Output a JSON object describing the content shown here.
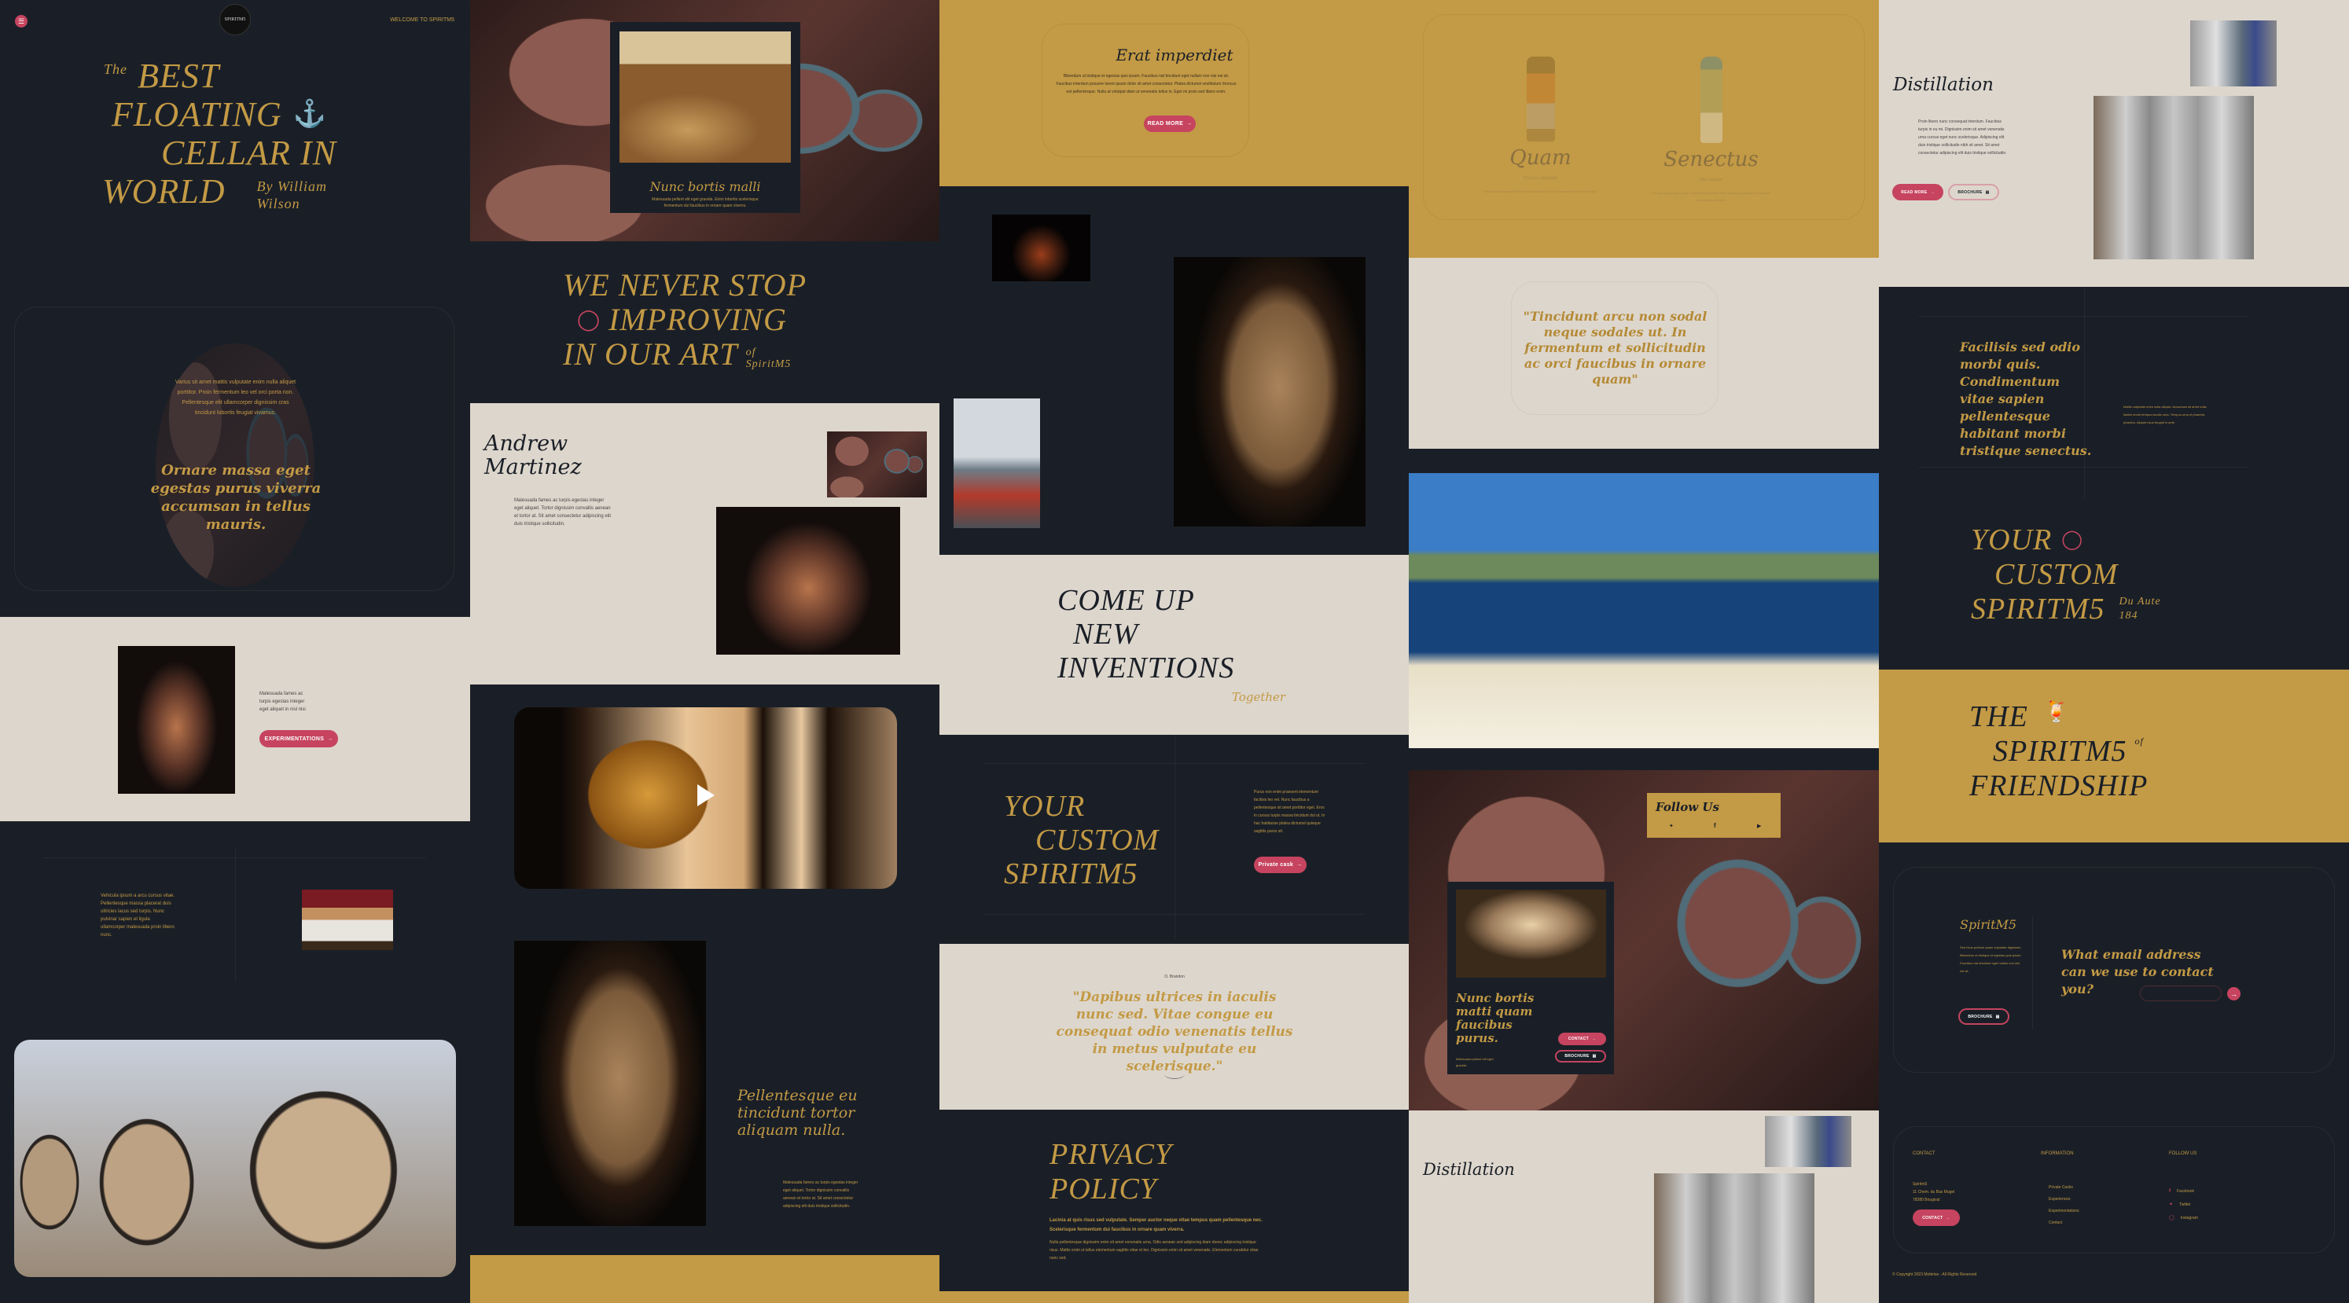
{
  "colors": {
    "navy": "#1a1f27",
    "gold": "#c39a45",
    "beige": "#ddd6cc",
    "pink": "#c6445f"
  },
  "col1": {
    "header": {
      "logo_text": "SPIRITM5",
      "welcome": "WELCOME TO SPIRITM5",
      "menu_icon": "hamburger-icon"
    },
    "hero": {
      "the": "The",
      "line1": "BEST",
      "line2": "FLOATING",
      "line3": "CELLAR IN",
      "line4": "WORLD",
      "byline1": "By William",
      "byline2": "Wilson",
      "icon": "anchor-icon"
    },
    "oval": {
      "body": "Varius sit amet mattis vulputate enim nulla aliquet porttitor. Proin fermentum leo vel orci porta non. Pellentesque elit ullamcorper dignissim cras tincidunt lobortis feugiat vivamus.",
      "quote": "Ornare massa eget egestas purus viverra accumsan in tellus mauris."
    },
    "experiment": {
      "text": "Malesuada fames ac turpis egestas integer eget aliquet in nisl nisi",
      "button": "EXPERIMENTATIONS"
    },
    "split": {
      "text": "Vehicula ipsum a arcu cursus vitae. Pellentesque massa placerat duis ultricies lacus sed turpis. Nunc pulvinar sapien et ligula ullamcorper malesuada proin libero nunc."
    }
  },
  "col2": {
    "card": {
      "title": "Nunc bortis malli",
      "body": "Malesuada pellent elit eget gravida. Enim lobortis scelerisque fermentum dui faucibus in ornare quam viverra."
    },
    "headline": {
      "line1": "WE NEVER STOP",
      "line2": "IMPROVING",
      "line3": "IN OUR ART",
      "of": "of",
      "brand": "SpiritM5",
      "icon": "barrel-icon"
    },
    "person": {
      "name1": "Andrew",
      "name2": "Martinez",
      "body": "Malesuada fames ac turpis egestas integer eget aliquet. Tortor dignissim convallis aenean et tortor at. Sit amet consectetur adipiscing elit duis tristique sollicitudin."
    },
    "video": {
      "play_icon": "play-icon"
    },
    "feature": {
      "title": "Pellentesque eu tincidunt tortor aliquam nulla.",
      "body": "Malesuada fames ac turpis egestas integer eget aliquet. Tortor dignissim convallis aenean et tortor at. Sit amet consectetur adipiscing elit duis tristique sollicitudin."
    }
  },
  "col3": {
    "card": {
      "title": "Erat imperdiet",
      "body": "Bibendum ut tristique et egestas quis ipsum. Faucibus nisl tincidunt eget nullam non nisi est sit. Faucibus interdum posuere lorem ipsum dolor sit amet consectetur. Platea dictumst vestibulum rhoncus est pellentesque. Nulla at volutpat diam ut venenatis tellus in. Eget mi proin sed libero enim.",
      "button": "READ MORE"
    },
    "inventions": {
      "line1": "COME UP",
      "line2": "NEW",
      "line3": "INVENTIONS",
      "tag": "Together"
    },
    "custom": {
      "line1": "YOUR",
      "line2": "CUSTOM",
      "line3": "SPIRITM5",
      "body": "Purus non enim praesent elementum facilisis leo vel. Nunc faucibus a pellentesque sit amet porttitor eget. Eros in cursus turpis massa tincidunt dui ut. In hac habitasse platea dictumst quisque sagittis purus sit.",
      "button": "Private cask"
    },
    "testimonial": {
      "author": "O. Brandon",
      "quote": "\"Dapibus ultrices in iaculis nunc sed. Vitae congue eu consequat odio venenatis tellus in metus vulputate eu scelerisque.\""
    },
    "privacy": {
      "line1": "PRIVACY",
      "line2": "POLICY",
      "lead": "Lacinia at quis risus sed vulputate. Semper auctor neque vitae tempus quam pellentesque nec. Scelerisque fermentum dui faucibus in ornare quam viverra.",
      "body": "Nulla pellentesque dignissim enim sit amet venenatis urna. Odio aenean sed adipiscing diam donec adipiscing tristique risus. Mattis enim ut tellus elementum sagittis vitae et leo. Dignissim enim sit amet venenatis. Elementum curabitur vitae nunc sed."
    }
  },
  "col4": {
    "products": [
      {
        "name": "Quam",
        "subtitle": "Posuere sollicitudin",
        "body": "Faucibus scelerisque eleifend donec pretium. Purus in massa tempor nec feugiat."
      },
      {
        "name": "Senectus",
        "subtitle": "Vitae semper",
        "body": "Posuere lorem ipsum dolor sit amet consectetur. Enim lobortis scelerisque fermentum dui faucibus praesent."
      }
    ],
    "quote": "\"Tincidunt arcu non sodal neque sodales ut. In fermentum et sollicitudin ac orci faucibus in ornare quam\"",
    "follow": {
      "title": "Follow Us",
      "icons": [
        "twitter-icon",
        "facebook-icon",
        "youtube-icon"
      ]
    },
    "card": {
      "title": "Nunc bortis matti quam faucibus purus.",
      "body": "Malesuada pellent elit eget gravida.",
      "contact": "CONTACT",
      "brochure": "BROCHURE"
    },
    "bottom_title": "Distillation"
  },
  "col5": {
    "distill": {
      "title": "Distillation",
      "body": "Proin libero nunc consequat interdum. Faucibus turpis in eu mi. Dignissim enim sit amet venenatis urna cursus eget nunc scelerisque. Adipiscing elit duis tristique sollicitudin nibh sit amet. Sit amet consectetur adipiscing elit duis tristique sollicitudin.",
      "read_more": "READ MORE",
      "brochure": "BROCHURE"
    },
    "facilisis": {
      "title": "Facilisis sed odio morbi quis. Condimentum vitae sapien pellentesque habitant morbi tristique senectus.",
      "body": "Mattis vulputate enim nulla aliquet. Accumsan sit amet nulla facilisi morbi tempus iaculis urna. Tempus urna et pharetra pharetra. Aliquet risus feugiat in ante."
    },
    "custom": {
      "line1": "YOUR",
      "line2": "CUSTOM",
      "line3": "SPIRITM5",
      "tag1": "Du Aute",
      "tag2": "184",
      "icon": "barrel-icon"
    },
    "friendship": {
      "line1": "THE",
      "line2": "SPIRITM5",
      "of": "of",
      "line3": "FRIENDSHIP",
      "icon": "cocktail-icon"
    },
    "newsletter": {
      "brand": "SpiritM5",
      "body": "Sed risus pretium quam vulputate dignissim. Bibendum ut tristique et egestas quis ipsum. Faucibus nisl tincidunt eget nullam non nisi est sit.",
      "brochure": "BROCHURE",
      "question": "What email address can we use to contact you?",
      "email_placeholder": ""
    },
    "footer": {
      "contact_heading": "CONTACT",
      "address": [
        "Spiritm5",
        "11 Chem. du Bas Mugel",
        "78380 Bougival"
      ],
      "contact_button": "CONTACT",
      "info_heading": "INFORMATION",
      "info_links": [
        "Private Casks",
        "Experiences",
        "Experimentations",
        "Contact"
      ],
      "follow_heading": "FOLLOW US",
      "social": [
        {
          "icon": "facebook-icon",
          "label": "Facebook"
        },
        {
          "icon": "twitter-icon",
          "label": "Twitter"
        },
        {
          "icon": "instagram-icon",
          "label": "Instagram"
        }
      ],
      "copyright": "© Copyright 2023 Mobirise - All Rights Reserved"
    }
  }
}
